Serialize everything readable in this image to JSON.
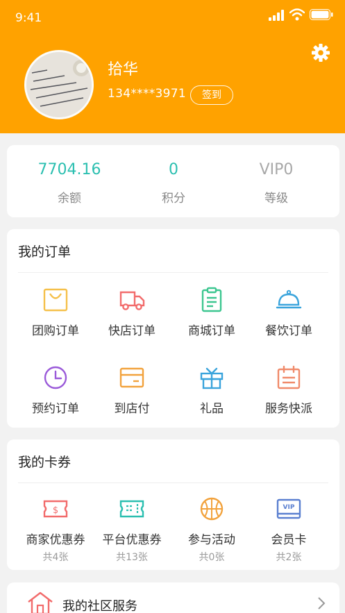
{
  "status_bar": {
    "time": "9:41"
  },
  "profile": {
    "name": "拾华",
    "phone": "134****3971",
    "checkin_label": "签到"
  },
  "stats": [
    {
      "value": "7704.16",
      "label": "余额",
      "color": "#2bbfb0"
    },
    {
      "value": "0",
      "label": "积分",
      "color": "#2bbfb0"
    },
    {
      "value": "VIP0",
      "label": "等级",
      "color": "#a8a8a8"
    }
  ],
  "orders": {
    "title": "我的订单",
    "items": [
      {
        "label": "团购订单",
        "icon": "shopping-bag-icon",
        "color": "#f5c04a"
      },
      {
        "label": "快店订单",
        "icon": "truck-icon",
        "color": "#f26b6b"
      },
      {
        "label": "商城订单",
        "icon": "clipboard-icon",
        "color": "#3cc690"
      },
      {
        "label": "餐饮订单",
        "icon": "food-cloche-icon",
        "color": "#3aa4dc"
      },
      {
        "label": "预约订单",
        "icon": "clock-icon",
        "color": "#9a5ad9"
      },
      {
        "label": "到店付",
        "icon": "card-icon",
        "color": "#f2a23c"
      },
      {
        "label": "礼品",
        "icon": "gift-icon",
        "color": "#3aa4dc"
      },
      {
        "label": "服务快派",
        "icon": "calendar-icon",
        "color": "#f08a6a"
      }
    ]
  },
  "coupons": {
    "title": "我的卡券",
    "items": [
      {
        "label": "商家优惠券",
        "count": "共4张",
        "icon": "merchant-coupon-icon",
        "color": "#f26b6b"
      },
      {
        "label": "平台优惠券",
        "count": "共13张",
        "icon": "platform-coupon-icon",
        "color": "#2bbfb0"
      },
      {
        "label": "参与活动",
        "count": "共0张",
        "icon": "basketball-icon",
        "color": "#f2a23c"
      },
      {
        "label": "会员卡",
        "count": "共2张",
        "icon": "vip-card-icon",
        "color": "#5a7fd0"
      }
    ]
  },
  "community": {
    "label": "我的社区服务"
  },
  "colors": {
    "brand": "#ffa200",
    "accent": "#2bbfb0"
  }
}
